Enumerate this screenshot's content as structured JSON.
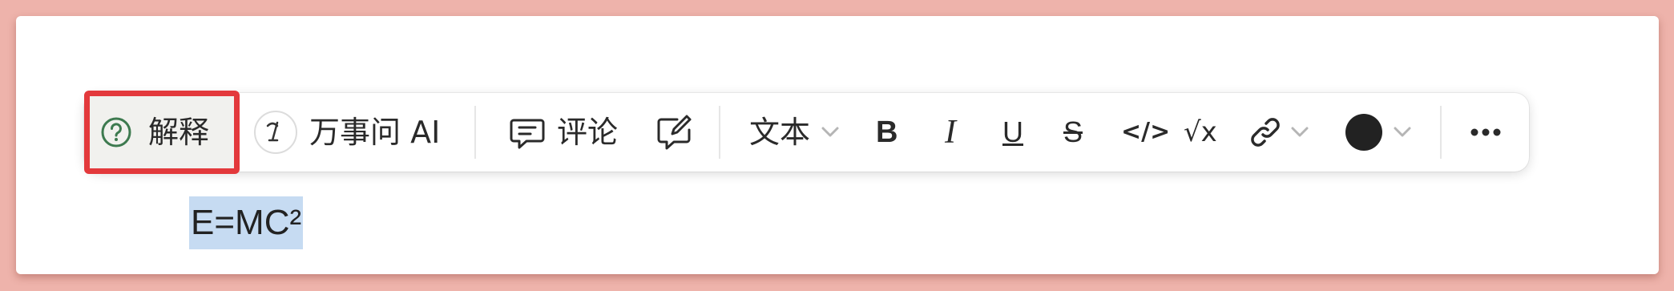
{
  "toolbar": {
    "explain_label": "解释",
    "ai_label": "万事问 AI",
    "comment_label": "评论",
    "text_style_label": "文本",
    "bold_label": "B",
    "italic_label": "I",
    "underline_label": "U",
    "strike_label": "S",
    "code_label": "</>",
    "math_label": "√x",
    "icons": {
      "explain": "question-circle-icon",
      "ai": "ai-assistant-icon",
      "comment": "comment-bubble-icon",
      "suggest": "edit-bubble-icon",
      "link": "link-icon",
      "more": "more-horizontal-icon"
    }
  },
  "editor": {
    "selected_text": "E=MC²"
  },
  "colors": {
    "highlight_border": "#e3393c",
    "selection": "#c6dbf2",
    "explain_icon": "#3d7a4f",
    "text_color_swatch": "#222222",
    "background": "#eeb3ab"
  }
}
